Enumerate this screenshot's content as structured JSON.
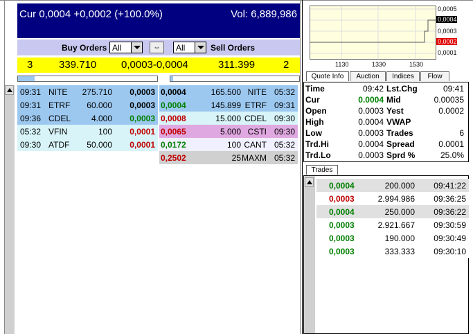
{
  "header": {
    "cur": "Cur 0,0004 +0,0002 (+100.0%)",
    "vol": "Vol: 6,889,986"
  },
  "orders_bar": {
    "buy_label": "Buy Orders",
    "sell_label": "Sell Orders",
    "buy_filter": "All",
    "sell_filter": "All",
    "link_icon": "link-icon"
  },
  "summary": {
    "buy_count": "3",
    "buy_volume": "339.710",
    "spread": "0,0003-0,0004",
    "sell_volume": "311.399",
    "sell_count": "2"
  },
  "progress": {
    "buy_fill": 0.12,
    "sell_fill": 0.02
  },
  "buy_orders": [
    {
      "time": "09:31",
      "mm": "NITE",
      "size": "275.710",
      "price": "0,0003",
      "bg": "#9cc8f0",
      "color": "black"
    },
    {
      "time": "09:31",
      "mm": "ETRF",
      "size": "60.000",
      "price": "0,0003",
      "bg": "#9cc8f0",
      "color": "black"
    },
    {
      "time": "09:36",
      "mm": "CDEL",
      "size": "4.000",
      "price": "0,0003",
      "bg": "#9cc8f0",
      "color": "green"
    },
    {
      "time": "05:32",
      "mm": "VFIN",
      "size": "100",
      "price": "0,0001",
      "bg": "#d8f4f8",
      "color": "red"
    },
    {
      "time": "09:30",
      "mm": "ATDF",
      "size": "50.000",
      "price": "0,0001",
      "bg": "#d8f4f8",
      "color": "red"
    }
  ],
  "sell_orders": [
    {
      "price": "0,0004",
      "size": "165.500",
      "mm": "NITE",
      "time": "05:32",
      "bg": "#9cc8f0",
      "color": "black"
    },
    {
      "price": "0,0004",
      "size": "145.899",
      "mm": "ETRF",
      "time": "09:31",
      "bg": "#9cc8f0",
      "color": "green"
    },
    {
      "price": "0,0008",
      "size": "15.000",
      "mm": "CDEL",
      "time": "09:30",
      "bg": "#d8f4f8",
      "color": "red"
    },
    {
      "price": "0,0065",
      "size": "5.000",
      "mm": "CSTI",
      "time": "09:30",
      "bg": "#e0a8e0",
      "color": "red"
    },
    {
      "price": "0,0172",
      "size": "100",
      "mm": "CANT",
      "time": "05:32",
      "bg": "#f0f0ff",
      "color": "green"
    },
    {
      "price": "0,2502",
      "size": "25",
      "mm": "MAXM",
      "time": "05:32",
      "bg": "#d0d0d0",
      "color": "red"
    }
  ],
  "chart": {
    "y_ticks": [
      "0,0005",
      "0,0004",
      "0,0003",
      "0,0002",
      "0,0001"
    ],
    "x_ticks": [
      "1130",
      "1330",
      "1530"
    ],
    "cur_highlight": "0,0004",
    "yest_highlight": "0,0002"
  },
  "tabs": [
    "Quote Info",
    "Auction",
    "Indices",
    "Flow"
  ],
  "quote": {
    "rows": [
      {
        "l1": "Time",
        "v1": "09:42",
        "l2": "Lst.Chg",
        "v2": "09:41",
        "v1color": "black"
      },
      {
        "l1": "Cur",
        "v1": "0.0004",
        "l2": "Mid",
        "v2": "0.00035",
        "v1color": "green"
      },
      {
        "l1": "Open",
        "v1": "0.0003",
        "l2": "Yest",
        "v2": "0.0002",
        "v1color": "black"
      },
      {
        "l1": "High",
        "v1": "0.0004",
        "l2": "VWAP",
        "v2": "",
        "v1color": "black"
      },
      {
        "l1": "Low",
        "v1": "0.0003",
        "l2": "Trades",
        "v2": "6",
        "v1color": "black"
      },
      {
        "l1": "Trd.Hi",
        "v1": "0.0004",
        "l2": "Spread",
        "v2": "0.0001",
        "v1color": "black"
      },
      {
        "l1": "Trd.Lo",
        "v1": "0.0003",
        "l2": "Sprd %",
        "v2": "25.0%",
        "v1color": "black"
      }
    ]
  },
  "trades_tab": "Trades",
  "trades": [
    {
      "price": "0,0004",
      "size": "200.000",
      "time": "09:41:22",
      "color": "green",
      "bg": "#e0e0e0"
    },
    {
      "price": "0,0003",
      "size": "2.994.986",
      "time": "09:36:25",
      "color": "red",
      "bg": "#ffffff"
    },
    {
      "price": "0,0004",
      "size": "250.000",
      "time": "09:36:22",
      "color": "green",
      "bg": "#e0e0e0"
    },
    {
      "price": "0,0003",
      "size": "2.921.667",
      "time": "09:30:59",
      "color": "green",
      "bg": "#ffffff"
    },
    {
      "price": "0,0003",
      "size": "190.000",
      "time": "09:30:49",
      "color": "green",
      "bg": "#ffffff"
    },
    {
      "price": "0,0003",
      "size": "333.333",
      "time": "09:30:10",
      "color": "green",
      "bg": "#ffffff"
    }
  ]
}
